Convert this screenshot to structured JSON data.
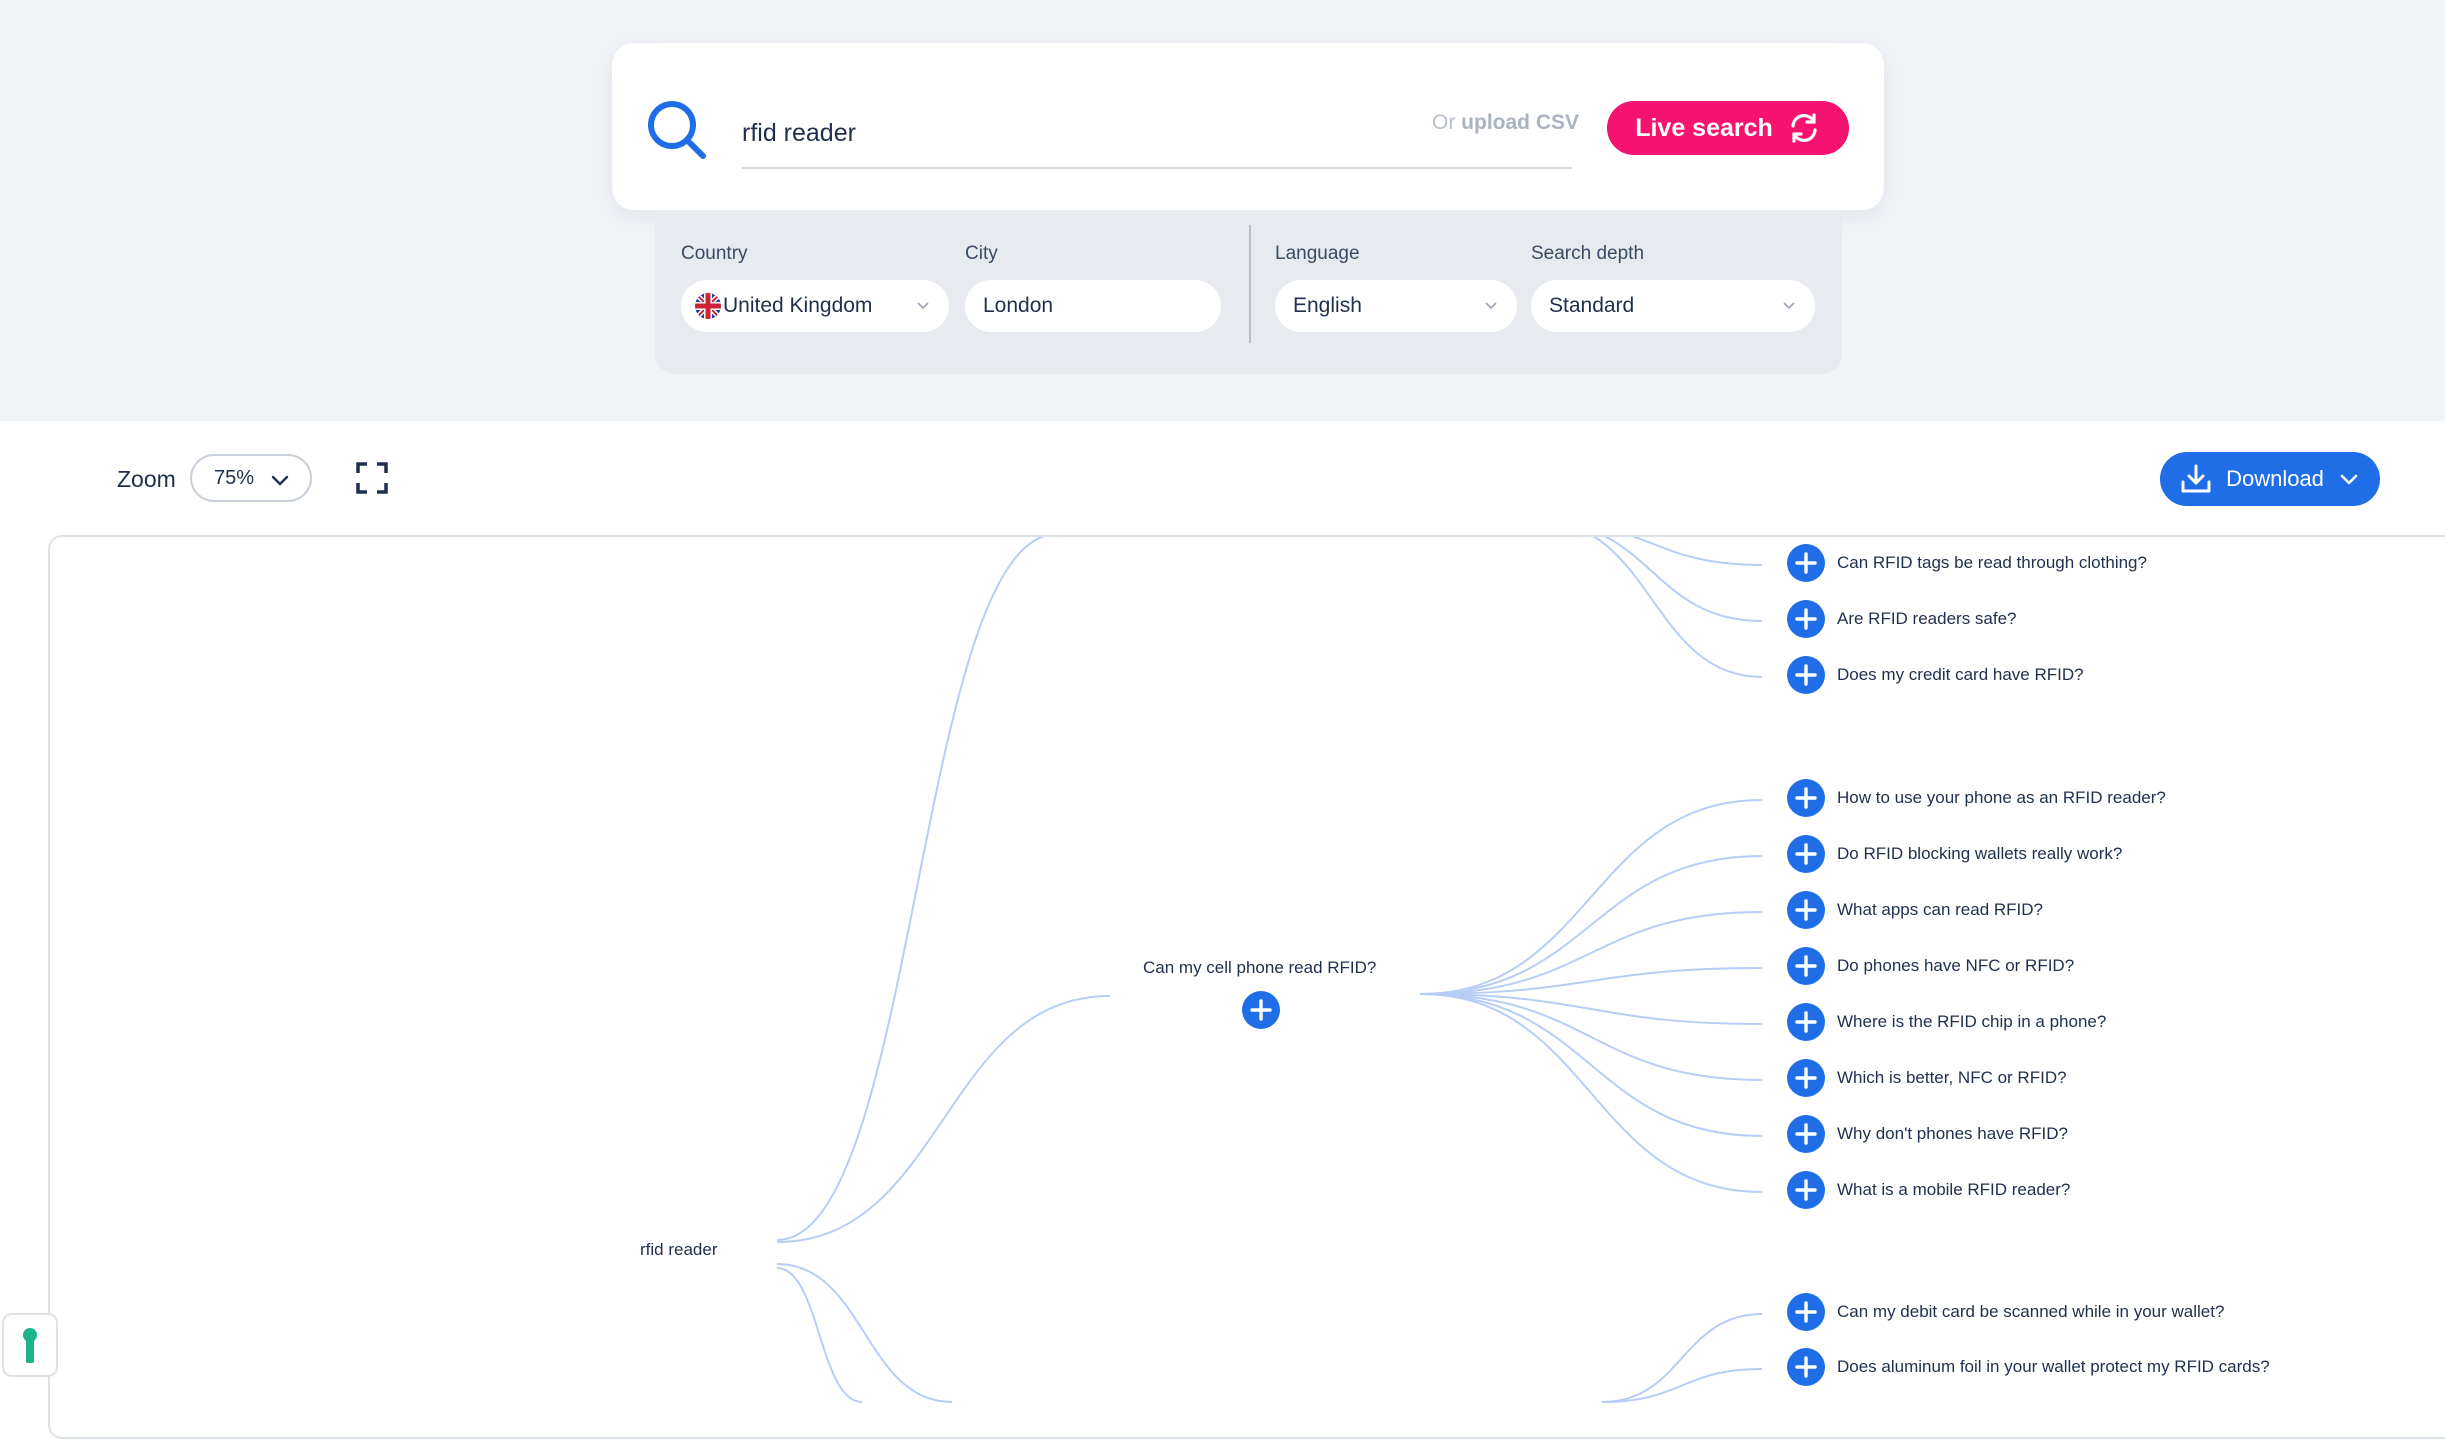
{
  "search": {
    "query": "rfid reader",
    "upload_prefix": "Or",
    "upload_link": "upload CSV",
    "live_search_label": "Live search"
  },
  "options": {
    "country_label": "Country",
    "country_value": "United Kingdom",
    "city_label": "City",
    "city_value": "London",
    "language_label": "Language",
    "language_value": "English",
    "depth_label": "Search depth",
    "depth_value": "Standard"
  },
  "toolbar": {
    "zoom_label": "Zoom",
    "zoom_value": "75%",
    "download_label": "Download"
  },
  "tree": {
    "root": "rfid reader",
    "branch": "Can my cell phone read RFID?",
    "top_group": [
      "Can RFID tags be read through clothing?",
      "Are RFID readers safe?",
      "Does my credit card have RFID?"
    ],
    "middle_group": [
      "How to use your phone as an RFID reader?",
      "Do RFID blocking wallets really work?",
      "What apps can read RFID?",
      "Do phones have NFC or RFID?",
      "Where is the RFID chip in a phone?",
      "Which is better, NFC or RFID?",
      "Why don't phones have RFID?",
      "What is a mobile RFID reader?"
    ],
    "bottom_group": [
      "Can my debit card be scanned while in your wallet?",
      "Does aluminum foil in your wallet protect my RFID cards?"
    ]
  },
  "colors": {
    "accent_blue": "#1f6ee8",
    "live_pink": "#f5136f",
    "link_line": "#b7cdf5"
  }
}
